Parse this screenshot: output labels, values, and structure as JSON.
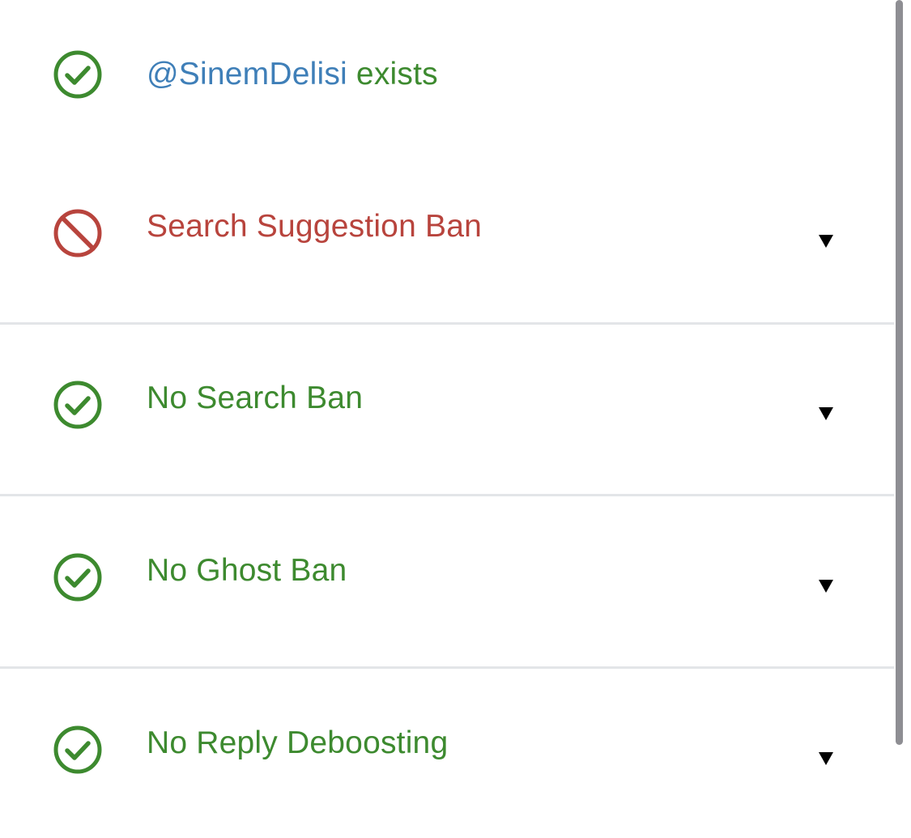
{
  "header": {
    "handle": "@SinemDelisi",
    "suffix": " exists",
    "status": "ok"
  },
  "checks": [
    {
      "label": "Search Suggestion Ban",
      "status": "ban"
    },
    {
      "label": "No Search Ban",
      "status": "ok"
    },
    {
      "label": "No Ghost Ban",
      "status": "ok"
    },
    {
      "label": "No Reply Deboosting",
      "status": "ok"
    }
  ],
  "colors": {
    "ok_green": "#3d8a2f",
    "ban_red": "#b8443d",
    "handle_blue": "#3f7fb8",
    "divider": "#e3e5e8"
  },
  "icons": {
    "ok": "check-circle-icon",
    "ban": "prohibited-icon",
    "expand": "caret-down-icon"
  }
}
